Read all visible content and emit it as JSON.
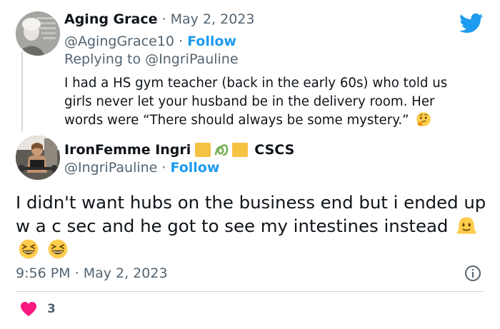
{
  "colors": {
    "accent": "#1d9bf0",
    "muted": "#536471",
    "text": "#0f1419",
    "like": "#f91880"
  },
  "parent_tweet": {
    "author_name": "Aging Grace",
    "separator": " · ",
    "date": "May 2, 2023",
    "handle": "@AgingGrace10",
    "follow_label": "Follow",
    "replying_prefix": "Replying to ",
    "replying_to": "@IngriPauline",
    "text": "I had a HS gym teacher (back in the early 60s) who told us girls never let your husband be in the delivery room. Her words were “There should always be some mystery.”",
    "emoji": "thinking-face-icon"
  },
  "main_tweet": {
    "author_name": "IronFemme Ingri",
    "name_suffix": "CSCS",
    "name_emojis": [
      "yellow-square-icon",
      "green-squiggle-icon",
      "yellow-square-icon"
    ],
    "handle": "@IngriPauline",
    "separator": " · ",
    "follow_label": "Follow",
    "text": "I didn't want hubs on the business end but i ended up w a c sec and he got to see my intestines instead",
    "emojis": [
      "melting-face-icon",
      "grinning-squinting-face-icon",
      "grinning-squinting-face-icon"
    ],
    "time": "9:56 PM",
    "date": "May 2, 2023",
    "like_count": "3"
  },
  "icons": {
    "brand": "twitter-bird-icon",
    "info": "info-icon",
    "like": "heart-icon"
  }
}
